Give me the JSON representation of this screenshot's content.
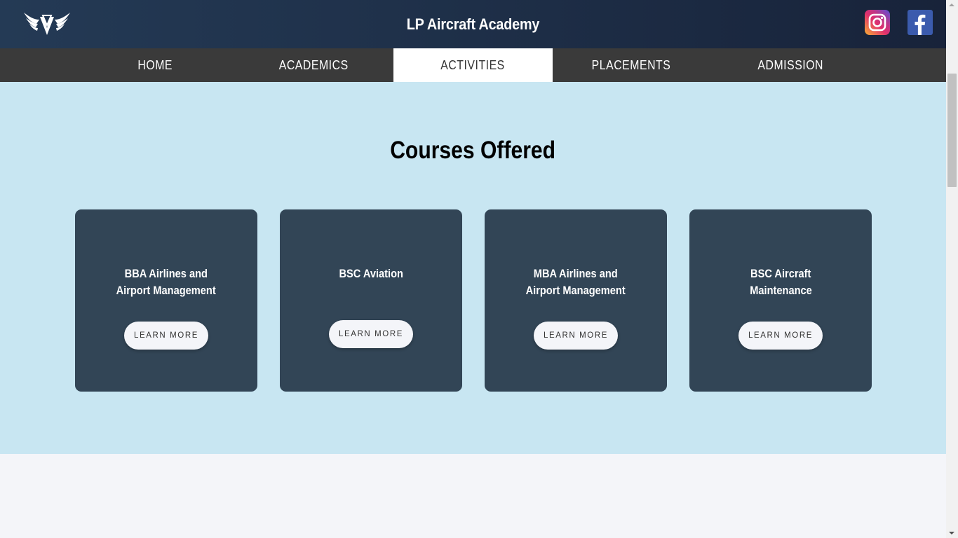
{
  "header": {
    "site_title": "LP Aircraft Academy",
    "logo_icon": "winged-emblem-icon",
    "social": [
      {
        "name": "instagram",
        "icon": "instagram-icon"
      },
      {
        "name": "facebook",
        "icon": "facebook-icon"
      }
    ]
  },
  "nav": {
    "items": [
      {
        "label": "HOME",
        "active": false
      },
      {
        "label": "ACADEMICS",
        "active": false
      },
      {
        "label": "ACTIVITIES",
        "active": true
      },
      {
        "label": "PLACEMENTS",
        "active": false
      },
      {
        "label": "ADMISSION",
        "active": false
      }
    ]
  },
  "courses": {
    "title": "Courses Offered",
    "cards": [
      {
        "title_line1": "BBA Airlines and",
        "title_line2": "Airport Management",
        "button": "LEARN MORE"
      },
      {
        "title_line1": "BSC Aviation",
        "title_line2": "",
        "button": "LEARN MORE"
      },
      {
        "title_line1": "MBA Airlines and",
        "title_line2": "Airport Management",
        "button": "LEARN MORE"
      },
      {
        "title_line1": "BSC Aircraft",
        "title_line2": "Maintenance",
        "button": "LEARN MORE"
      }
    ]
  },
  "colors": {
    "header_bg": "#1e2f48",
    "nav_bg": "#3a3a3a",
    "section_bg": "#c8e6f2",
    "card_bg": "#324556",
    "page_bg": "#f4f5f9"
  }
}
